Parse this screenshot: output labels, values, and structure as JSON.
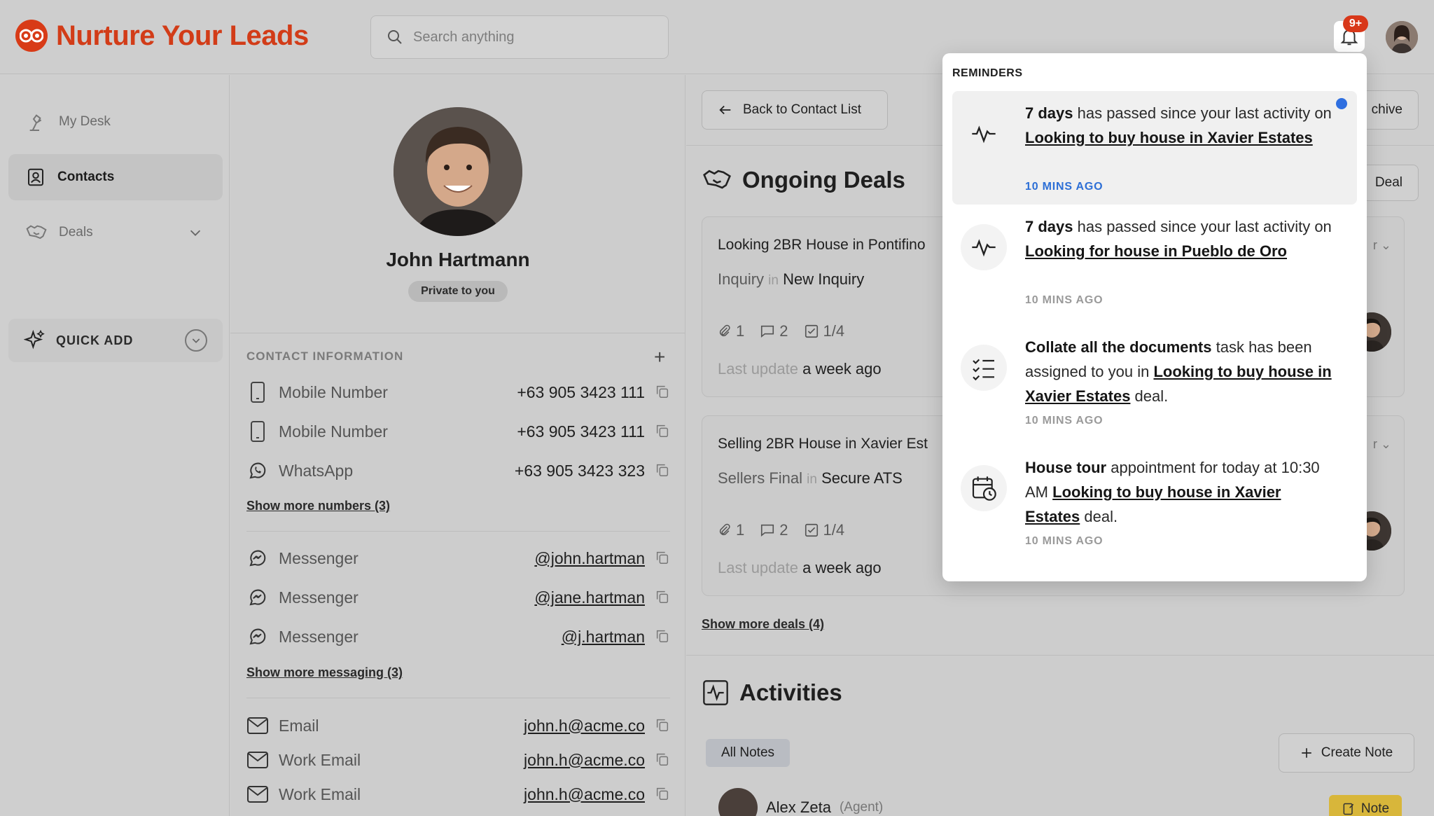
{
  "header": {
    "brand": "Nurture Your Leads",
    "search_placeholder": "Search anything",
    "notification_count": "9+"
  },
  "sidebar": {
    "items": [
      {
        "label": "My Desk"
      },
      {
        "label": "Contacts"
      },
      {
        "label": "Deals"
      }
    ],
    "quick_add": "QUICK ADD"
  },
  "contact": {
    "name": "John Hartmann",
    "visibility": "Private to you",
    "section_title": "CONTACT INFORMATION",
    "numbers": [
      {
        "label": "Mobile Number",
        "value": "+63 905 3423 111"
      },
      {
        "label": "Mobile Number",
        "value": "+63 905 3423 111"
      },
      {
        "label": "WhatsApp",
        "value": "+63 905 3423 323"
      }
    ],
    "show_more_numbers": "Show more numbers (3)",
    "messaging": [
      {
        "label": "Messenger",
        "value": "@john.hartman"
      },
      {
        "label": "Messenger",
        "value": "@jane.hartman"
      },
      {
        "label": "Messenger",
        "value": "@j.hartman"
      }
    ],
    "show_more_messaging": "Show more messaging (3)",
    "emails": [
      {
        "label": "Email",
        "value": "john.h@acme.co"
      },
      {
        "label": "Work Email",
        "value": "john.h@acme.co"
      },
      {
        "label": "Work Email",
        "value": "john.h@acme.co"
      }
    ]
  },
  "main": {
    "back_label": "Back to Contact List",
    "archive_label": "chive",
    "deals_title": "Ongoing Deals",
    "add_deal_label": "Deal",
    "deals": [
      {
        "title": "Looking 2BR House in Pontifino",
        "stage": "Inquiry",
        "in": "in",
        "pipeline": "New Inquiry",
        "attachments": "1",
        "comments": "2",
        "tasks": "1/4",
        "updated_prefix": "Last update",
        "updated": "a week ago",
        "owner_initial": "r"
      },
      {
        "title": "Selling 2BR House in Xavier Est",
        "stage": "Sellers Final",
        "in": "in",
        "pipeline": "Secure ATS",
        "attachments": "1",
        "comments": "2",
        "tasks": "1/4",
        "updated_prefix": "Last update",
        "updated": "a week ago",
        "owner_initial": "r"
      }
    ],
    "show_more_deals": "Show more deals (4)",
    "activities_title": "Activities",
    "all_notes": "All Notes",
    "create_note": "Create Note",
    "note_author": "Alex Zeta",
    "note_role": "(Agent)",
    "note_tag": "Note"
  },
  "reminders": {
    "title": "REMINDERS",
    "items": [
      {
        "bold": "7 days",
        "text": " has passed since your last activity on ",
        "link": "Looking to buy house in Xavier Estates",
        "suffix": "",
        "time": "10 MINS AGO",
        "unread": true,
        "icon": "activity-icon"
      },
      {
        "bold": "7 days",
        "text": " has passed since your last activity on ",
        "link": "Looking for house in Pueblo de Oro",
        "suffix": "",
        "time": "10 MINS AGO",
        "unread": false,
        "icon": "activity-icon"
      },
      {
        "bold": "Collate all the documents",
        "text": " task has been assigned to you in ",
        "link": "Looking to buy house in Xavier Estates",
        "suffix": " deal.",
        "time": "10 MINS AGO",
        "unread": false,
        "icon": "checklist-icon"
      },
      {
        "bold": "House tour",
        "text": " appointment for today at 10:30 AM ",
        "link": "Looking to buy house in Xavier Estates",
        "suffix": " deal.",
        "time": "10 MINS AGO",
        "unread": false,
        "icon": "calendar-clock-icon"
      }
    ]
  }
}
